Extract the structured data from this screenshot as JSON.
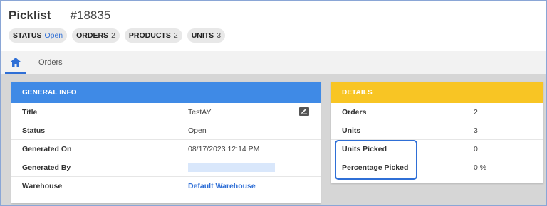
{
  "header": {
    "title": "Picklist",
    "number": "#18835",
    "chips": [
      {
        "key": "STATUS",
        "value": "Open"
      },
      {
        "key": "ORDERS",
        "value": "2"
      },
      {
        "key": "PRODUCTS",
        "value": "2"
      },
      {
        "key": "UNITS",
        "value": "3"
      }
    ]
  },
  "tabs": {
    "home_icon": "home-icon",
    "orders_label": "Orders"
  },
  "general_info": {
    "heading": "GENERAL INFO",
    "rows": [
      {
        "label": "Title",
        "value": "TestAY"
      },
      {
        "label": "Status",
        "value": "Open"
      },
      {
        "label": "Generated On",
        "value": "08/17/2023 12:14 PM"
      },
      {
        "label": "Generated By",
        "value": ""
      },
      {
        "label": "Warehouse",
        "value": "Default Warehouse"
      }
    ]
  },
  "details": {
    "heading": "DETAILS",
    "rows": [
      {
        "label": "Orders",
        "value": "2"
      },
      {
        "label": "Units",
        "value": "3"
      },
      {
        "label": "Units Picked",
        "value": "0"
      },
      {
        "label": "Percentage Picked",
        "value": "0 %"
      }
    ]
  },
  "colors": {
    "general_header": "#3f8ae6",
    "details_header": "#f8c524",
    "accent": "#2f6fd6"
  }
}
